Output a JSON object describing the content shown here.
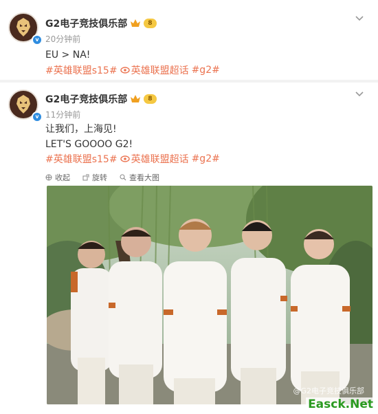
{
  "posts": [
    {
      "author": "G2电子竞技俱乐部",
      "vip_level": "8",
      "time": "20分钟前",
      "lines": [
        "EU > NA!"
      ],
      "tags": [
        "#英雄联盟s15#",
        "英雄联盟超话",
        "#g2#"
      ]
    },
    {
      "author": "G2电子竞技俱乐部",
      "vip_level": "8",
      "time": "11分钟前",
      "lines": [
        "让我们，上海见!",
        "LET'S GOOOO G2!"
      ],
      "tags": [
        "#英雄联盟s15#",
        "英雄联盟超话",
        "#g2#"
      ],
      "actions": {
        "collapse": "收起",
        "rotate": "旋转",
        "view_large": "查看大图"
      },
      "photo_watermark": "@G2电子竞技俱乐部"
    }
  ],
  "site_watermark": "Easck.Net",
  "colors": {
    "tag": "#eb7350",
    "verified": "#2f8de0",
    "vip": "#f5c842"
  },
  "icons": [
    "g2-logo-icon",
    "verified-icon",
    "crown-icon",
    "chevron-down-icon",
    "supertopic-icon",
    "collapse-icon",
    "rotate-icon",
    "view-large-icon"
  ]
}
